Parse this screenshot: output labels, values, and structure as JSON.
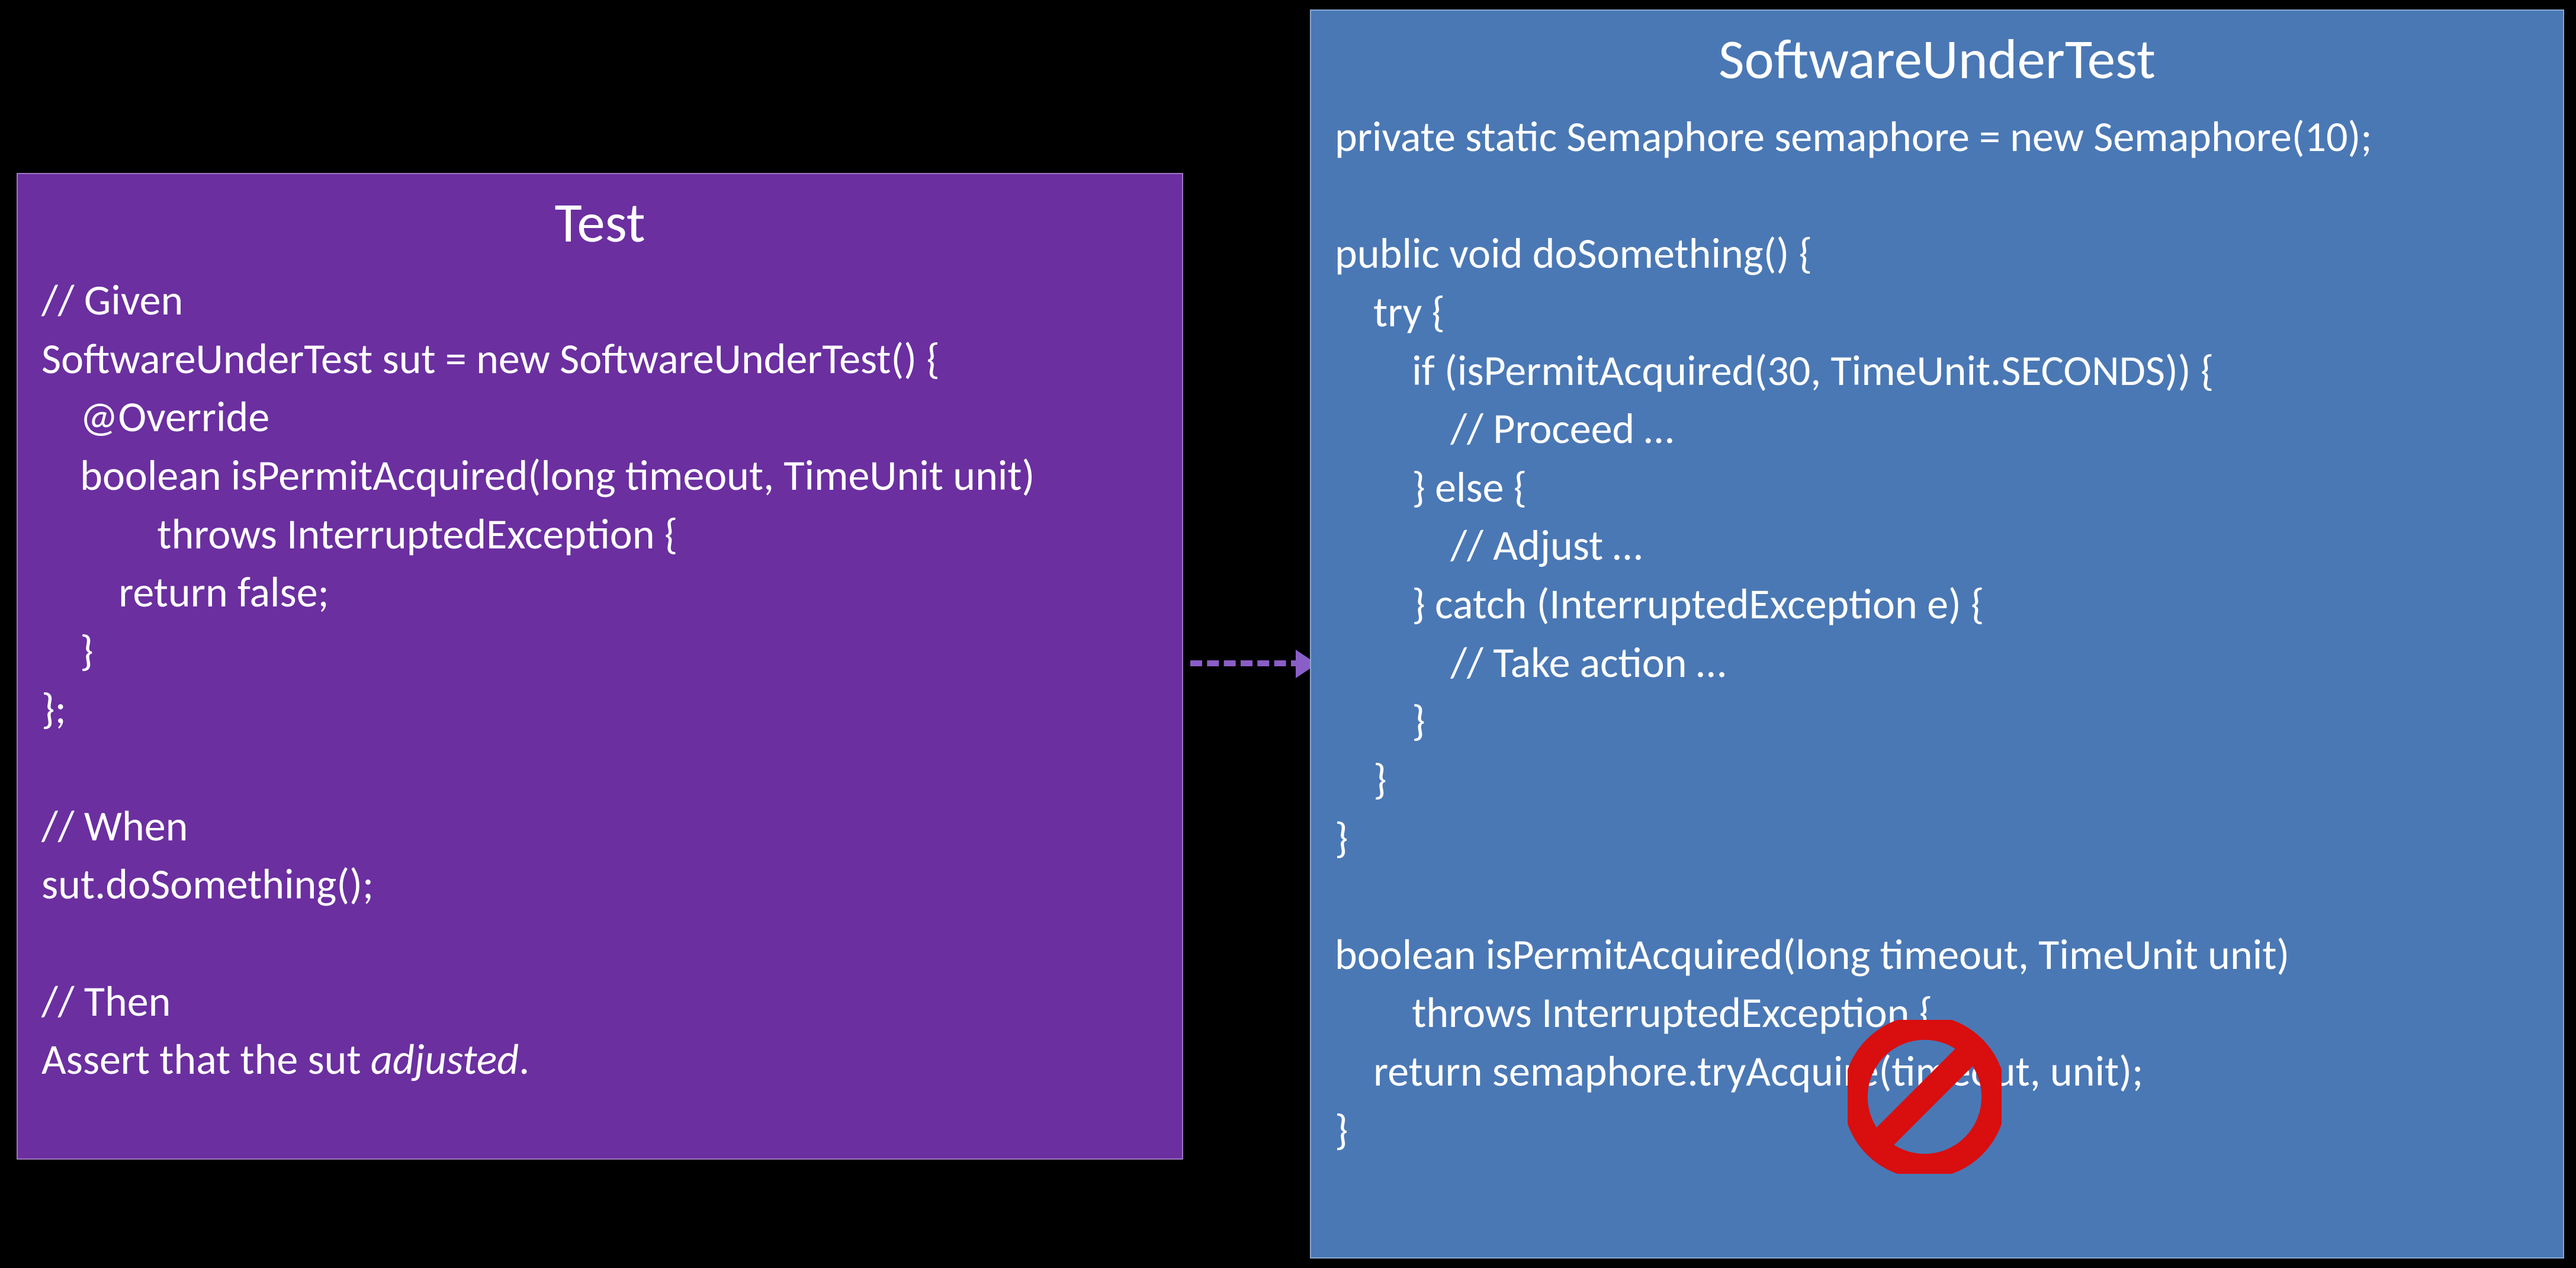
{
  "left": {
    "title": "Test",
    "lines": [
      "// Given",
      "SoftwareUnderTest sut = new SoftwareUnderTest() {",
      "    @Override",
      "    boolean isPermitAcquired(long timeout, TimeUnit unit)",
      "            throws InterruptedException {",
      "        return false;",
      "    }",
      "};",
      "",
      "// When",
      "sut.doSomething();",
      "",
      "// Then"
    ],
    "assert_prefix": "Assert that the sut ",
    "assert_em": "adjusted",
    "assert_suffix": "."
  },
  "right": {
    "title": "SoftwareUnderTest",
    "lines": [
      "private static Semaphore semaphore = new Semaphore(10);",
      "",
      "public void doSomething() {",
      "    try {",
      "        if (isPermitAcquired(30, TimeUnit.SECONDS)) {",
      "            // Proceed …",
      "        } else {",
      "            // Adjust …",
      "        } catch (InterruptedException e) {",
      "            // Take action …",
      "        }",
      "    }",
      "}",
      "",
      "boolean isPermitAcquired(long timeout, TimeUnit unit)",
      "        throws InterruptedException {",
      "    return semaphore.tryAcquire(timeout, unit);",
      "}"
    ]
  },
  "colors": {
    "left_bg": "#6b2fa0",
    "right_bg": "#4a78b5",
    "arrow": "#8a5ec7",
    "prohibit": "#d90e0e"
  }
}
